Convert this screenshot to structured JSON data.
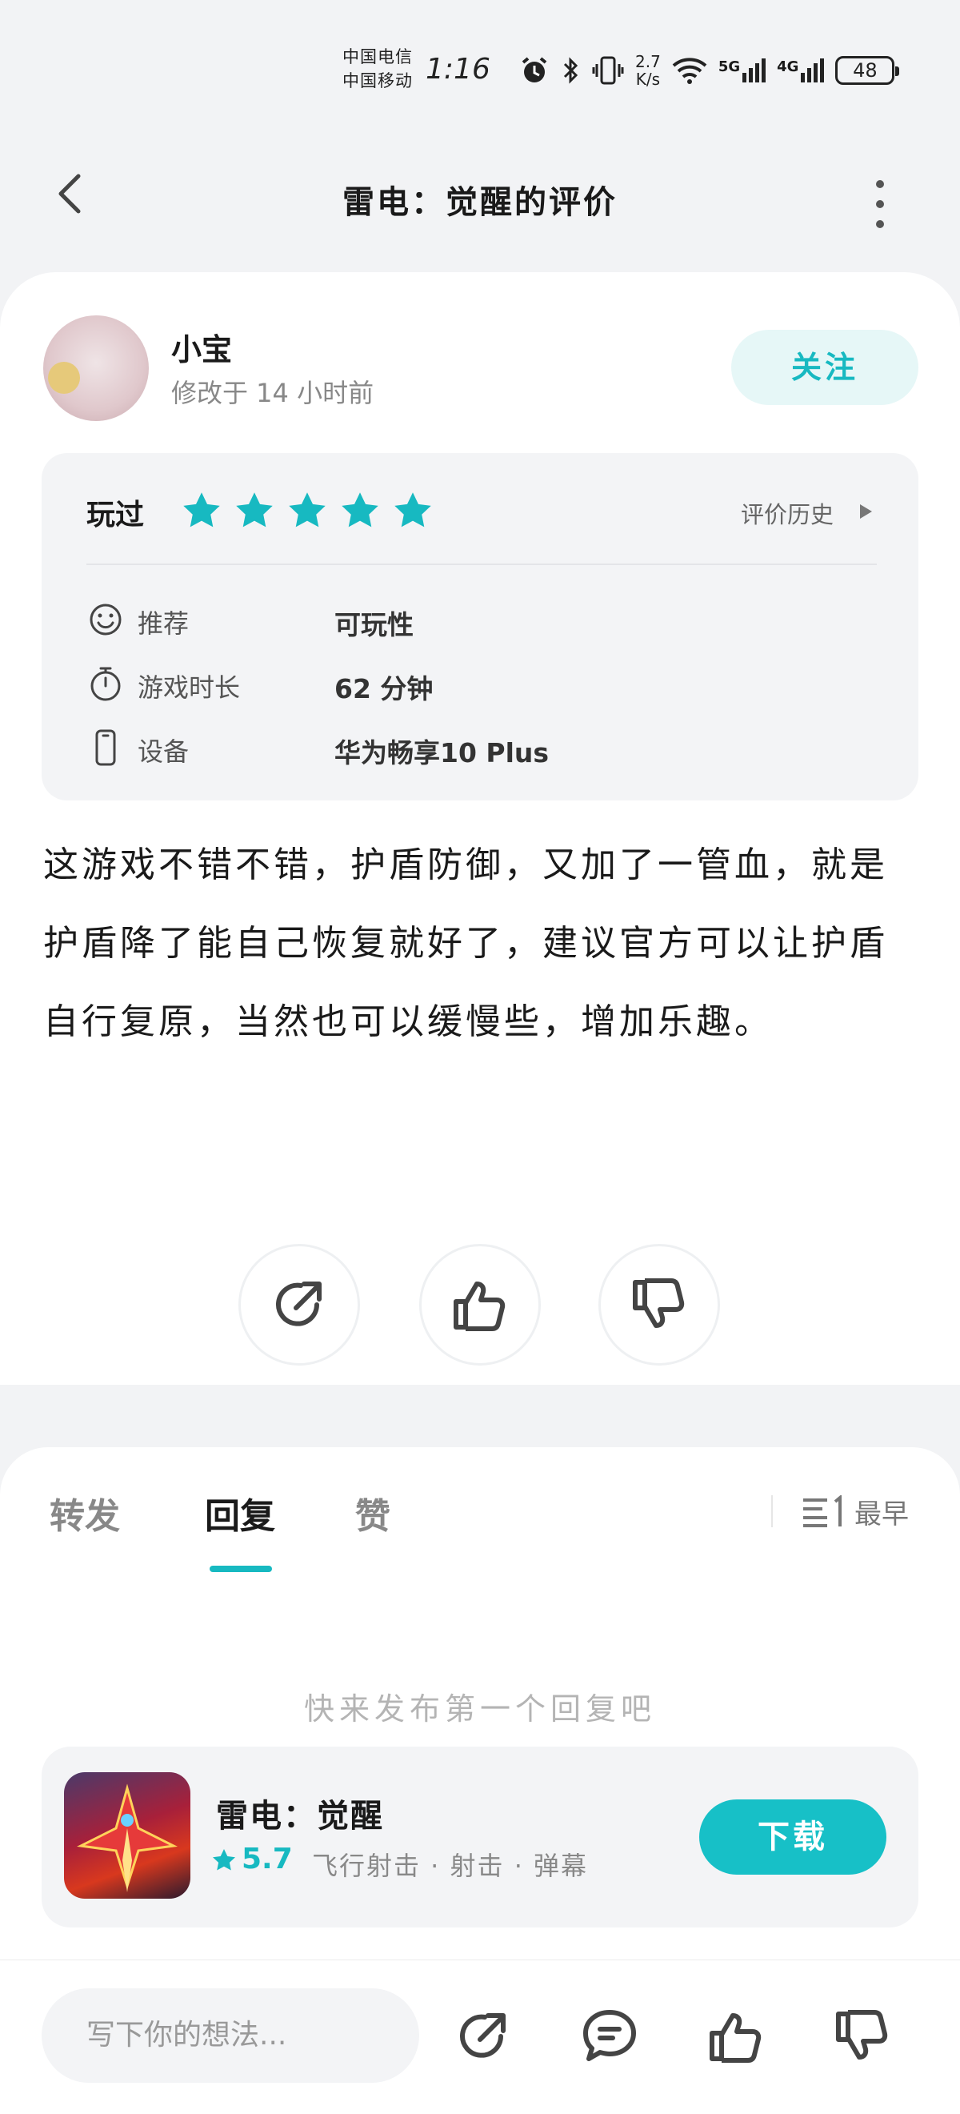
{
  "status_bar": {
    "carrier1": "中国电信",
    "carrier2": "中国移动",
    "time": "1:16",
    "net_speed_value": "2.7",
    "net_speed_unit": "K/s",
    "net1": "5G",
    "net2": "4G",
    "battery": "48"
  },
  "header": {
    "title": "雷电：觉醒的评价"
  },
  "review": {
    "username": "小宝",
    "modified": "修改于 14 小时前",
    "follow_label": "关注",
    "played_label": "玩过",
    "stars": 5,
    "history_label": "评价历史",
    "details": [
      {
        "label": "推荐",
        "value": "可玩性",
        "icon": "smile-icon"
      },
      {
        "label": "游戏时长",
        "value": "62 分钟",
        "icon": "stopwatch-icon"
      },
      {
        "label": "设备",
        "value": "华为畅享10 Plus",
        "icon": "phone-icon"
      }
    ],
    "text": "这游戏不错不错，护盾防御，又加了一管血，就是护盾降了能自己恢复就好了，建议官方可以让护盾自行复原，当然也可以缓慢些，增加乐趣。"
  },
  "tabs": {
    "items": [
      "转发",
      "回复",
      "赞"
    ],
    "active": 1,
    "sort_label": "最早"
  },
  "empty_text": "快来发布第一个回复吧",
  "game": {
    "name": "雷电：觉醒",
    "score": "5.7",
    "tags": "飞行射击 · 射击 · 弹幕",
    "download_label": "下载"
  },
  "bottom_bar": {
    "input_placeholder": "写下你的想法..."
  },
  "colors": {
    "accent": "#17b9c1",
    "background": "#f2f3f5"
  }
}
